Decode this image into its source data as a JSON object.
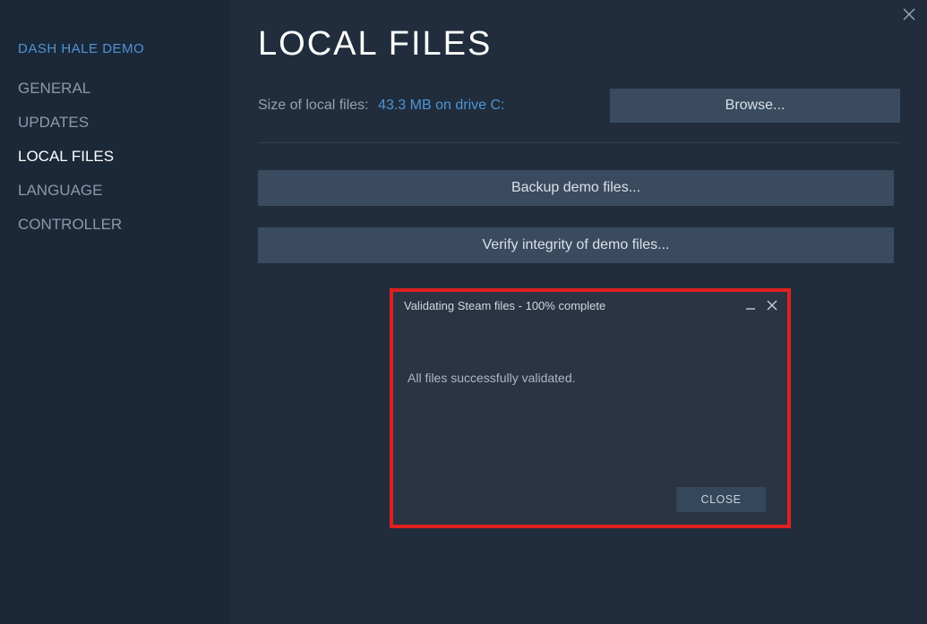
{
  "sidebar": {
    "title": "DASH HALE DEMO",
    "items": [
      {
        "label": "GENERAL"
      },
      {
        "label": "UPDATES"
      },
      {
        "label": "LOCAL FILES",
        "active": true
      },
      {
        "label": "LANGUAGE"
      },
      {
        "label": "CONTROLLER"
      }
    ]
  },
  "main": {
    "title": "LOCAL FILES",
    "size_label": "Size of local files:",
    "size_value": "43.3 MB on drive C:",
    "browse_label": "Browse...",
    "backup_label": "Backup demo files...",
    "verify_label": "Verify integrity of demo files..."
  },
  "dialog": {
    "title": "Validating Steam files - 100% complete",
    "message": "All files successfully validated.",
    "close_label": "CLOSE"
  }
}
